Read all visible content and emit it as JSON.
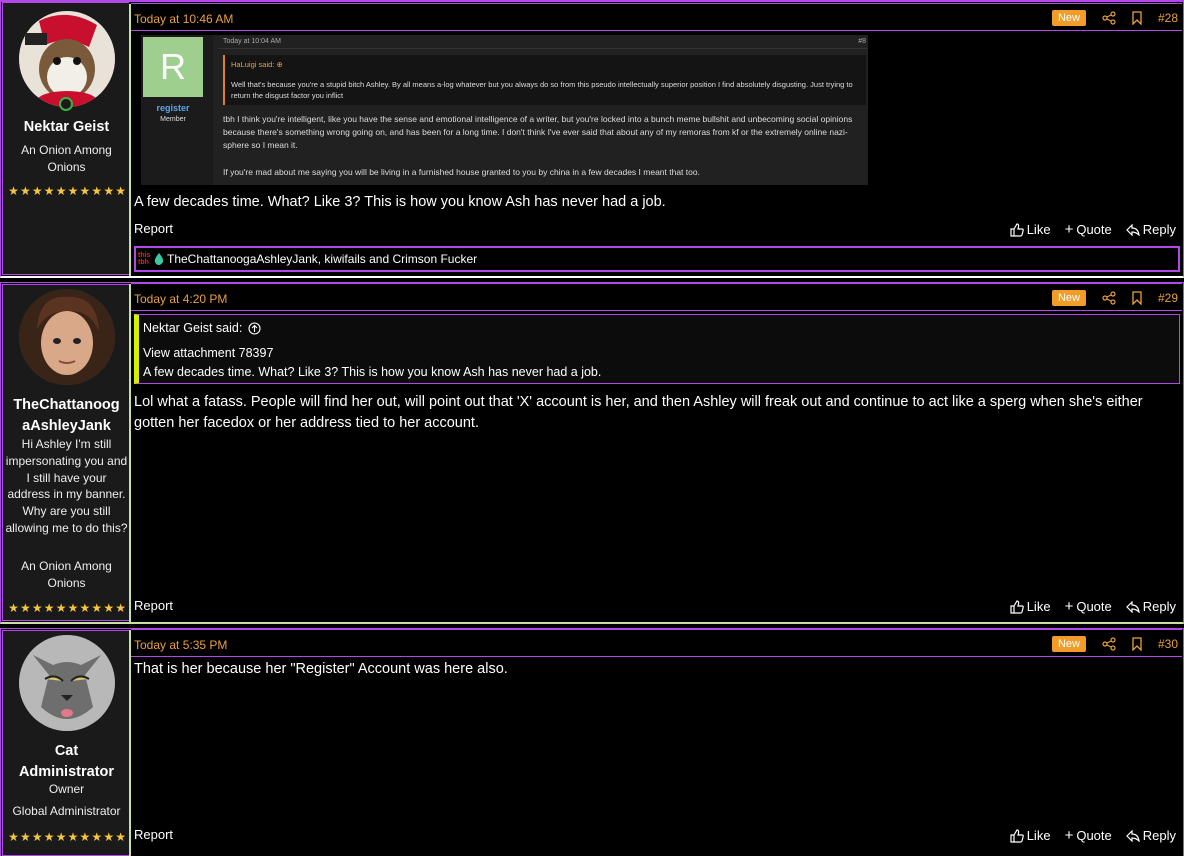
{
  "posts": [
    {
      "timestamp": "Today at 10:46 AM",
      "badge": "New",
      "number": "#28",
      "user": {
        "name": "Nektar Geist",
        "title": "An Onion Among Onions",
        "extra": ""
      },
      "attachment": {
        "timestamp": "Today at 10:04 AM",
        "number": "#8",
        "avatar_letter": "R",
        "username": "register",
        "role": "Member",
        "quote_author": "HaLuigi said: ⊕",
        "quote_text": "Well that's because you're a stupid bitch Ashley. By all means a-log whatever but you always do so from this pseudo intellectually superior position I find absolutely disgusting. Just trying to return the disgust factor you inflict",
        "reply_p1": "tbh I think you're intelligent, like you have the sense and emotional intelligence of a writer, but you're locked into a bunch meme bullshit and unbecoming social opinions because there's something wrong going on, and has been for a long time. I don't think I've ever said that about any of my remoras from kf or the extremely online nazi-sphere so I mean it.",
        "reply_p2": "If you're mad about me saying you will be living in a furnished house granted to you by china in a few decades I meant that too."
      },
      "body": "A few decades time. What? Like 3? This is how you know Ash has never had a job.",
      "reactions": "TheChattanoogaAshleyJank, kiwifails and Crimson Fucker",
      "reaction_icon_text": "this tbh"
    },
    {
      "timestamp": "Today at 4:20 PM",
      "badge": "New",
      "number": "#29",
      "user": {
        "name": "TheChattanoogaAshleyJank",
        "name_line1": "TheChattanoog",
        "name_line2": "aAshleyJank",
        "bio": "Hi Ashley I'm still impersonating you and I still have your address in my banner. Why are you still allowing me to do this?",
        "title": "An Onion Among Onions"
      },
      "quote": {
        "author": "Nektar Geist said:",
        "line1": "View attachment 78397",
        "line2": "A few decades time. What? Like 3? This is how you know Ash has never had a job."
      },
      "body": "Lol what a fatass. People will find her out, will point out that 'X' account is her, and then Ashley will freak out and continue to act like a sperg when she's either gotten her facedox or her address tied to her account."
    },
    {
      "timestamp": "Today at 5:35 PM",
      "badge": "New",
      "number": "#30",
      "user": {
        "name": "Cat Administrator",
        "name_line1": "Cat",
        "name_line2": "Administrator",
        "role": "Owner",
        "title": "Global Administrator"
      },
      "body": "That is her because her \"Register\" Account was here also."
    }
  ],
  "actions": {
    "report": "Report",
    "like": "Like",
    "quote": "Quote",
    "reply": "Reply"
  },
  "colors": {
    "accent": "#b348e8",
    "timestamp": "#e8a040",
    "badge": "#f29c2a",
    "quote_bar": "#d6f000"
  }
}
